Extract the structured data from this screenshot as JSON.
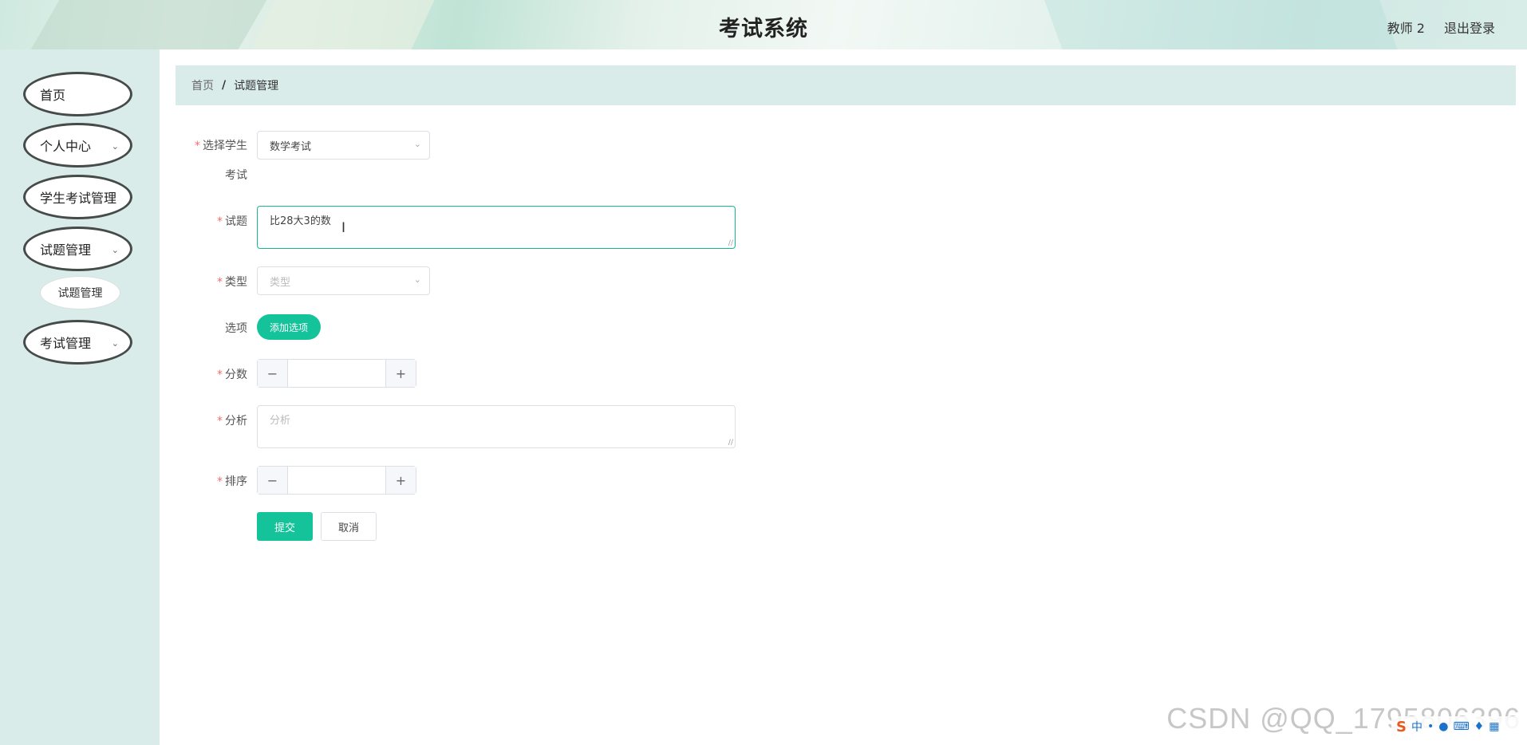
{
  "header": {
    "title": "考试系统",
    "user": "教师 2",
    "logout_label": "退出登录"
  },
  "sidebar": {
    "items": [
      {
        "label": "首页",
        "has_submenu": false
      },
      {
        "label": "个人中心",
        "has_submenu": true
      },
      {
        "label": "学生考试管理",
        "has_submenu": false
      },
      {
        "label": "试题管理",
        "has_submenu": true
      },
      {
        "label": "考试管理",
        "has_submenu": true
      }
    ],
    "subitem": {
      "label": "试题管理"
    }
  },
  "breadcrumb": {
    "home": "首页",
    "separator": "/",
    "current": "试题管理"
  },
  "form": {
    "exam": {
      "label_line1": "选择学生",
      "label_line2": "考试",
      "value": "数学考试"
    },
    "question": {
      "label": "试题",
      "value": "比28大3的数"
    },
    "type": {
      "label": "类型",
      "placeholder": "类型"
    },
    "options": {
      "label": "选项",
      "add_label": "添加选项"
    },
    "score": {
      "label": "分数",
      "value": ""
    },
    "analysis": {
      "label": "分析",
      "placeholder": "分析"
    },
    "order": {
      "label": "排序",
      "value": ""
    },
    "submit_label": "提交",
    "cancel_label": "取消",
    "required_mark": "*",
    "minus": "−",
    "plus": "+"
  },
  "watermark": "CSDN @QQ_1795806396",
  "tray": {
    "ime_label": "中"
  },
  "colors": {
    "accent": "#15c39a",
    "sidebar_bg": "#daecea",
    "required": "#f56c6c"
  }
}
